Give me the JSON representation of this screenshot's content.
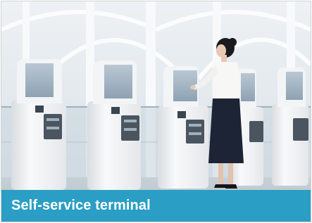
{
  "card": {
    "caption": "Self-service terminal",
    "caption_bg": "#2a9ec4",
    "caption_color": "#ffffff"
  },
  "photo": {
    "subject": "kiosks"
  }
}
